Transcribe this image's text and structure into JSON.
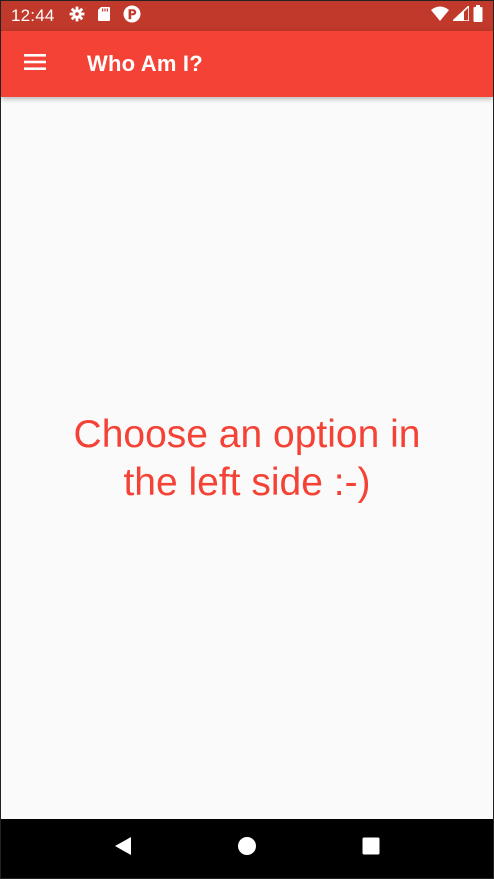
{
  "status_bar": {
    "time": "12:44",
    "left_icons": [
      "gear-icon",
      "sd-card-icon",
      "app-notification-icon"
    ],
    "right_icons": [
      "wifi-icon",
      "cell-signal-icon",
      "battery-icon"
    ]
  },
  "app_bar": {
    "menu_icon": "hamburger-menu-icon",
    "title": "Who Am I?",
    "background": "#f44336"
  },
  "main": {
    "message": "Choose an option in the left side :-)",
    "message_color": "#f44336",
    "background": "#fafafa"
  },
  "nav_bar": {
    "buttons": [
      "back-icon",
      "home-icon",
      "recents-icon"
    ]
  }
}
